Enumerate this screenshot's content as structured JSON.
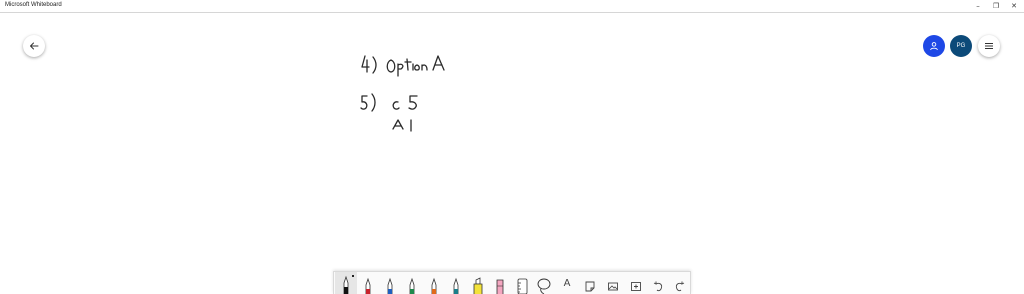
{
  "window": {
    "title": "Microsoft Whiteboard",
    "minimize": "–",
    "maximize": "❐",
    "close": "✕"
  },
  "header": {
    "avatar_initials": "PG"
  },
  "colors": {
    "invite": "#1e48e6",
    "avatar": "#0c4a79",
    "pen_black": "#111111",
    "pen_red": "#c8232c",
    "pen_blue": "#1f5fbf",
    "pen_green": "#1f8a4c",
    "pen_orange": "#e06a1a",
    "pen_teal": "#1a7f8a",
    "highlighter_yellow": "#f3e23a",
    "highlighter_pink": "#f4a6c0"
  },
  "icons": {
    "back": "arrow-left-icon",
    "invite": "person-icon",
    "menu": "hamburger-icon",
    "stencil": "ruler-icon",
    "lasso": "lasso-icon",
    "text": "text-icon",
    "note": "sticky-note-icon",
    "image": "image-icon",
    "insert": "insert-icon",
    "undo": "undo-icon",
    "redo": "redo-icon"
  },
  "toolbar": {
    "text_glyph": "A"
  }
}
